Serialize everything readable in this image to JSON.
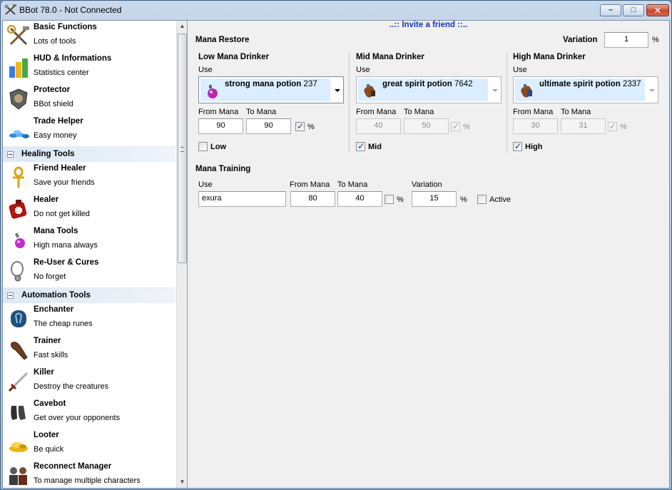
{
  "window": {
    "title": "BBot 78.0 - Not Connected",
    "minimize": "–",
    "maximize": "□",
    "close": "✕"
  },
  "sidebar": {
    "items": [
      {
        "name": "basic-functions",
        "title": "Basic Functions",
        "subtitle": "Lots of tools",
        "icon": "tools-icon"
      },
      {
        "name": "hud-informations",
        "title": "HUD & Informations",
        "subtitle": "Statistics center",
        "icon": "statistics-icon"
      },
      {
        "name": "protector",
        "title": "Protector",
        "subtitle": "BBot shield",
        "icon": "shield-icon"
      },
      {
        "name": "trade-helper",
        "title": "Trade Helper",
        "subtitle": "Easy money",
        "icon": "coins-icon"
      }
    ],
    "group_healing": "Healing Tools",
    "healing_items": [
      {
        "name": "friend-healer",
        "title": "Friend Healer",
        "subtitle": "Save your friends",
        "icon": "ankh-icon"
      },
      {
        "name": "healer",
        "title": "Healer",
        "subtitle": "Do not get killed",
        "icon": "health-backpack-icon"
      },
      {
        "name": "mana-tools",
        "title": "Mana Tools",
        "subtitle": "High mana always",
        "icon": "mana-potion-icon"
      },
      {
        "name": "re-user-cures",
        "title": "Re-User & Cures",
        "subtitle": "No forget",
        "icon": "amulet-icon"
      }
    ],
    "group_automation": "Automation Tools",
    "automation_items": [
      {
        "name": "enchanter",
        "title": "Enchanter",
        "subtitle": "The cheap runes",
        "icon": "rune-icon"
      },
      {
        "name": "trainer",
        "title": "Trainer",
        "subtitle": "Fast skills",
        "icon": "club-icon"
      },
      {
        "name": "killer",
        "title": "Killer",
        "subtitle": "Destroy the creatures",
        "icon": "sword-icon"
      },
      {
        "name": "cavebot",
        "title": "Cavebot",
        "subtitle": "Get over your opponents",
        "icon": "boots-icon"
      },
      {
        "name": "looter",
        "title": "Looter",
        "subtitle": "Be quick",
        "icon": "gold-icon"
      },
      {
        "name": "reconnect-manager",
        "title": "Reconnect Manager",
        "subtitle": "To manage multiple characters",
        "icon": "characters-icon"
      }
    ]
  },
  "invite": "..:: Invite a friend ::..",
  "mana_restore": {
    "title": "Mana Restore",
    "variation_label": "Variation",
    "variation_value": "1",
    "variation_unit": "%",
    "low": {
      "title": "Low Mana Drinker",
      "use": "Use",
      "potion": "strong mana potion",
      "count": "237",
      "from_label": "From Mana",
      "to_label": "To Mana",
      "from": "90",
      "to": "90",
      "pct": "%",
      "enabled_label": "Low",
      "enabled": false
    },
    "mid": {
      "title": "Mid Mana Drinker",
      "use": "Use",
      "potion": "great spirit potion",
      "count": "7642",
      "from_label": "From Mana",
      "to_label": "To Mana",
      "from": "40",
      "to": "50",
      "pct": "%",
      "enabled_label": "Mid",
      "enabled": true
    },
    "high": {
      "title": "High Mana Drinker",
      "use": "Use",
      "potion": "ultimate spirit potion",
      "count": "2337",
      "from_label": "From Mana",
      "to_label": "To Mana",
      "from": "30",
      "to": "31",
      "pct": "%",
      "enabled_label": "High",
      "enabled": true
    }
  },
  "mana_training": {
    "title": "Mana Training",
    "use_label": "Use",
    "spell": "exura",
    "from_label": "From Mana",
    "from": "80",
    "to_label": "To Mana",
    "to": "40",
    "pct": "%",
    "variation_label": "Variation",
    "variation": "15",
    "variation_unit": "%",
    "active_label": "Active",
    "active": false
  },
  "colors": {
    "invite_link": "#1535c4",
    "selection": "#dbeeff",
    "group_header": "#dce8f4"
  },
  "checkmark": "✓"
}
